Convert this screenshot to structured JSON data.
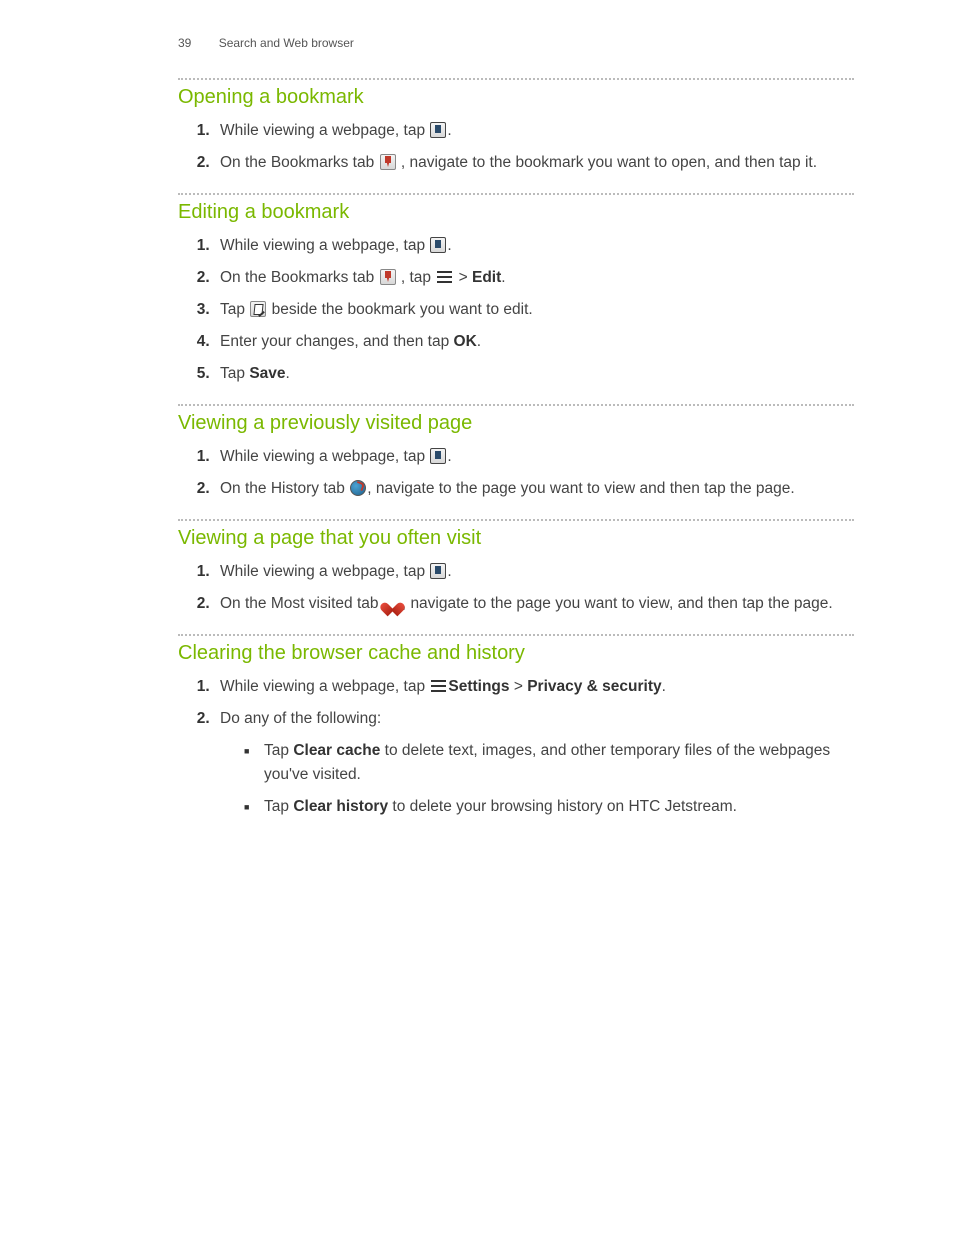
{
  "header": {
    "page_number": "39",
    "chapter": "Search and Web browser"
  },
  "sections": [
    {
      "title": "Opening a bookmark",
      "steps": [
        {
          "pre": "While viewing a webpage, tap ",
          "icon": "bookmarks-icon",
          "post": "."
        },
        {
          "pre": "On the Bookmarks tab ",
          "icon": "bookmark-ribbon-icon",
          "post": " , navigate to the bookmark you want to open, and then tap it."
        }
      ]
    },
    {
      "title": "Editing a bookmark",
      "steps": [
        {
          "pre": "While viewing a webpage, tap ",
          "icon": "bookmarks-icon",
          "post": "."
        },
        {
          "pre": "On the Bookmarks tab ",
          "icon": "bookmark-ribbon-icon",
          "mid": " , tap ",
          "icon2": "menu-icon",
          "post2": " > ",
          "bold": "Edit",
          "post3": "."
        },
        {
          "pre": "Tap ",
          "icon": "edit-icon",
          "post": " beside the bookmark you want to edit."
        },
        {
          "pre": "Enter your changes, and then tap ",
          "bold": "OK",
          "post": "."
        },
        {
          "pre": "Tap ",
          "bold": "Save",
          "post": "."
        }
      ]
    },
    {
      "title": "Viewing a previously visited page",
      "steps": [
        {
          "pre": "While viewing a webpage, tap ",
          "icon": "bookmarks-icon",
          "post": "."
        },
        {
          "pre": "On the History tab ",
          "icon": "history-icon",
          "post": ", navigate to the page you want to view and then tap the page."
        }
      ]
    },
    {
      "title": "Viewing a page that you often visit",
      "steps": [
        {
          "pre": "While viewing a webpage, tap ",
          "icon": "bookmarks-icon",
          "post": "."
        },
        {
          "pre": "On the Most visited tab ",
          "icon": "heart-icon",
          "post": ", navigate to the page you want to view, and then tap the page."
        }
      ]
    },
    {
      "title": "Clearing the browser cache and history",
      "steps": [
        {
          "pre": "While viewing a webpage, tap ",
          "icon": "menu-icon",
          "post": " > ",
          "bold": "Settings",
          "mid2": " > ",
          "bold2": "Privacy & security",
          "post3": "."
        },
        {
          "pre": "Do any of the following:",
          "bullets": [
            {
              "pre": "Tap ",
              "bold": "Clear cache",
              "post": " to delete text, images, and other temporary files of the webpages you've visited."
            },
            {
              "pre": "Tap ",
              "bold": "Clear history",
              "post": " to delete your browsing history on HTC Jetstream."
            }
          ]
        }
      ]
    }
  ]
}
